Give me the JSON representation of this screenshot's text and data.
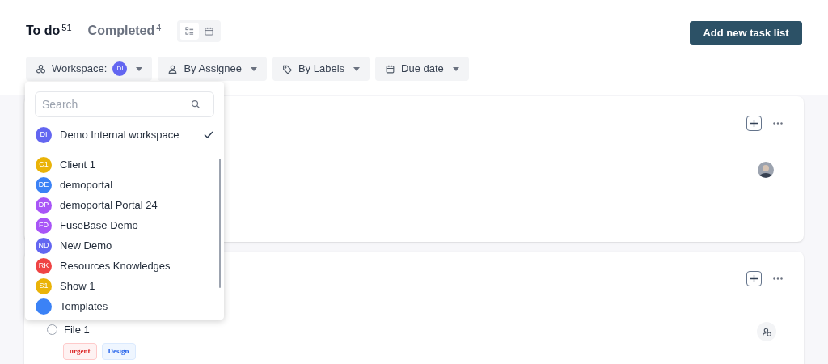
{
  "tabs": [
    {
      "label": "To do",
      "count": "51",
      "selected": true
    },
    {
      "label": "Completed",
      "count": "4",
      "selected": false
    }
  ],
  "view_toggle": [
    {
      "kind": "list",
      "selected": true
    },
    {
      "kind": "calendar",
      "selected": false
    }
  ],
  "add_button": "Add new task list",
  "filters": [
    {
      "kind": "workspace",
      "label": "Workspace:",
      "badge": "DI"
    },
    {
      "kind": "assignee",
      "label": "By Assignee"
    },
    {
      "kind": "labels",
      "label": "By Labels"
    },
    {
      "kind": "date",
      "label": "Due date"
    }
  ],
  "dropdown": {
    "search": {
      "placeholder": "Search"
    },
    "current": {
      "initials": "DI",
      "name": "Demo Internal workspace",
      "color": "#6366f1",
      "selected": true
    },
    "items": [
      {
        "initials": "C1",
        "name": "Client 1",
        "color": "#eab308",
        "selected": false
      },
      {
        "initials": "DE",
        "name": "demoportal",
        "color": "#3b82f6",
        "selected": false
      },
      {
        "initials": "DP",
        "name": "demoportal Portal 24",
        "color": "#a855f7",
        "selected": false
      },
      {
        "initials": "FD",
        "name": "FuseBase Demo",
        "color": "#a855f7",
        "selected": false
      },
      {
        "initials": "ND",
        "name": "New Demo",
        "color": "#6366f1",
        "selected": false
      },
      {
        "initials": "RK",
        "name": "Resources Knowledges",
        "color": "#ef4444",
        "selected": false
      },
      {
        "initials": "S1",
        "name": "Show 1",
        "color": "#eab308",
        "selected": false
      },
      {
        "name": "Templates",
        "color": "#3b82f6",
        "selected": false
      }
    ]
  },
  "lists": [
    {
      "tasks": [
        {
          "assignee": {
            "kind": "photo"
          }
        }
      ]
    },
    {
      "tasks": [
        {
          "title": "File 1",
          "checked": false,
          "assignee": {
            "kind": "unassigned"
          },
          "labels": [
            {
              "text": "urgent",
              "kind": "red"
            },
            {
              "text": "Design",
              "kind": "blue"
            }
          ]
        }
      ]
    }
  ]
}
